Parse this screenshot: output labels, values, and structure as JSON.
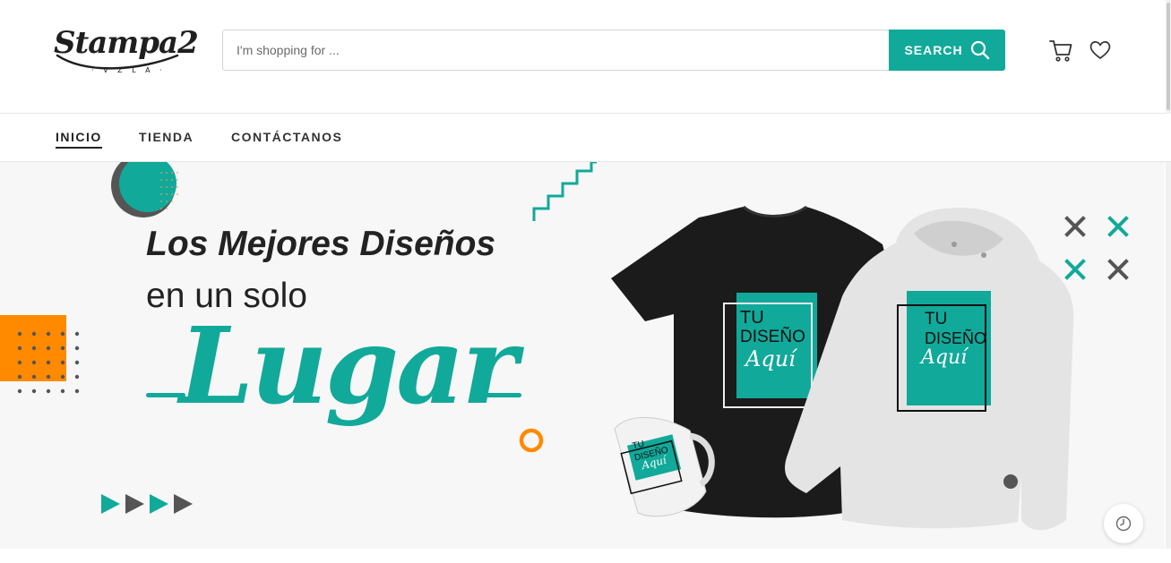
{
  "brand": {
    "logo_text": "Stampa2",
    "logo_sub": "· V Z L A ·"
  },
  "search": {
    "placeholder": "I'm shopping for ...",
    "value": "",
    "button_label": "SEARCH",
    "icon": "search-icon"
  },
  "header_icons": [
    "cart-icon",
    "heart-icon"
  ],
  "nav": {
    "items": [
      {
        "label": "INICIO",
        "active": true
      },
      {
        "label": "TIENDA",
        "active": false
      },
      {
        "label": "CONTÁCTANOS",
        "active": false
      }
    ]
  },
  "banner": {
    "line1": "Los Mejores Diseños",
    "line2": "en un solo",
    "line3": "Lugar",
    "print_line1": "TU",
    "print_line2": "DISEÑO",
    "print_line3": "Aquí"
  },
  "colors": {
    "accent": "#11a99a",
    "orange": "#ff8a00",
    "dark": "#222222",
    "grey": "#555555"
  },
  "floating": {
    "history_icon": "history-clock-icon"
  }
}
